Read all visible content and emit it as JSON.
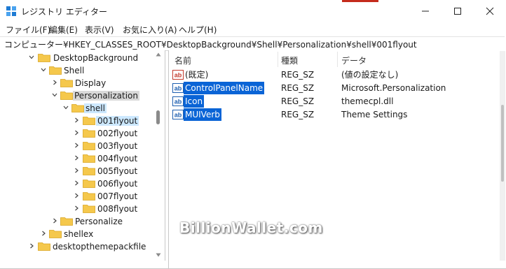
{
  "window": {
    "title": "レジストリ エディター"
  },
  "menu": [
    "ファイル(F)",
    "編集(E)",
    "表示(V)",
    "お気に入り(A)",
    "ヘルプ(H)"
  ],
  "address": "コンピューター¥HKEY_CLASSES_ROOT¥DesktopBackground¥Shell¥Personalization¥shell¥001flyout",
  "tree": {
    "desktop_background": "DesktopBackground",
    "shell": "Shell",
    "display": "Display",
    "personalization": "Personalization",
    "shell_lower": "shell",
    "flyout1": "001flyout",
    "flyout2": "002flyout",
    "flyout3": "003flyout",
    "flyout4": "004flyout",
    "flyout5": "005flyout",
    "flyout6": "006flyout",
    "flyout7": "007flyout",
    "flyout8": "008flyout",
    "personalize": "Personalize",
    "shellex": "shellex",
    "desktopthemepackfile": "desktopthemepackfile"
  },
  "columns": {
    "name": "名前",
    "type": "種類",
    "data": "データ"
  },
  "values": [
    {
      "name": "(既定)",
      "type": "REG_SZ",
      "data": "(値の設定なし)"
    },
    {
      "name": "ControlPanelName",
      "type": "REG_SZ",
      "data": "Microsoft.Personalization"
    },
    {
      "name": "Icon",
      "type": "REG_SZ",
      "data": "themecpl.dll"
    },
    {
      "name": "MUIVerb",
      "type": "REG_SZ",
      "data": "Theme Settings"
    }
  ],
  "watermark": "BillionWallet.com",
  "colors": {
    "accent": "#0a64d6",
    "folder": "#f5c84c",
    "selection_blue": "#cce8ff",
    "selection_gray": "#d9d9d9",
    "title_strip": "#c42b1c"
  },
  "icons": {
    "app": "regedit-icon",
    "folder": "folder-icon",
    "string_value": "reg-sz-icon",
    "minimize": "minimize-icon",
    "maximize": "maximize-icon",
    "close": "close-icon"
  }
}
